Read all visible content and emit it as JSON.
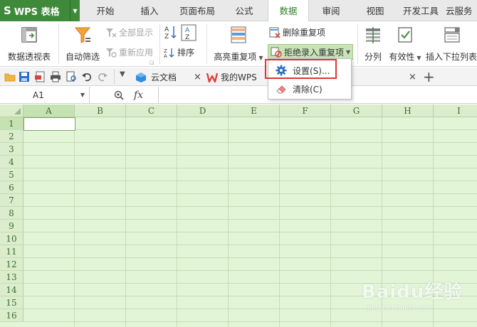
{
  "app": {
    "logo": "S",
    "title": "WPS 表格"
  },
  "menu_tabs": [
    {
      "label": "开始"
    },
    {
      "label": "插入"
    },
    {
      "label": "页面布局"
    },
    {
      "label": "公式"
    },
    {
      "label": "数据",
      "active": true
    },
    {
      "label": "审阅"
    },
    {
      "label": "视图"
    },
    {
      "label": "开发工具"
    },
    {
      "label": "云服务"
    }
  ],
  "ribbon": {
    "pivot_table": "数据透视表",
    "auto_filter": "自动筛选",
    "show_all": "全部显示",
    "reapply": "重新应用",
    "sort": "排序",
    "highlight_duplicates": "高亮重复项",
    "delete_duplicates": "删除重复项",
    "reject_duplicates": "拒绝录入重复项",
    "split_column": "分列",
    "validity": "有效性",
    "insert_dropdown": "插入下拉列表"
  },
  "doc_tabs": [
    {
      "label": "云文档"
    },
    {
      "label": "我的WPS"
    }
  ],
  "formula_bar": {
    "cell_ref": "A1",
    "fx": "fx",
    "value": ""
  },
  "columns": [
    "A",
    "B",
    "C",
    "D",
    "E",
    "F",
    "G",
    "H",
    "I"
  ],
  "rows": [
    "1",
    "2",
    "3",
    "4",
    "5",
    "6",
    "7",
    "8",
    "9",
    "10",
    "11",
    "12",
    "13",
    "14",
    "15",
    "16"
  ],
  "dropdown": {
    "items": [
      {
        "label": "设置(S)...",
        "icon": "gear-icon"
      },
      {
        "label": "清除(C)",
        "icon": "eraser-icon"
      }
    ]
  },
  "watermark": {
    "text": "Baidu经验",
    "sub": "jingyan.baidu.com"
  },
  "colors": {
    "app_green": "#3f8a3a",
    "active_tab_text": "#2e7c2a",
    "grid_bg": "#e3f5d7",
    "header_bg": "#dcedcd",
    "highlight_red": "#e0362f"
  }
}
